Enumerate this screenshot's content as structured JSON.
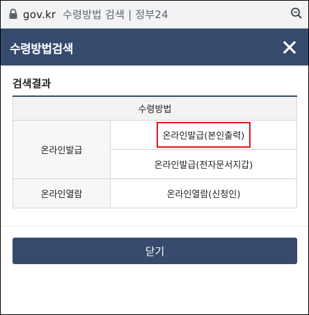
{
  "browser": {
    "host": "gov.kr",
    "page_title": "수령방법 검색",
    "site_name": "정부24",
    "separator": "|"
  },
  "modal": {
    "title": "수령방법검색",
    "close_icon": "close-icon",
    "section_title": "검색결과",
    "table": {
      "header": "수령방법",
      "rows": [
        {
          "category": "온라인발급",
          "options": [
            "온라인발급(본인출력)",
            "온라인발급(전자문서지갑)"
          ]
        },
        {
          "category": "온라인열람",
          "options": [
            "온라인열람(신청인)"
          ]
        }
      ]
    },
    "close_button_label": "닫기"
  },
  "colors": {
    "header_bg": "#364a6d",
    "highlight_border": "#e3141a"
  }
}
